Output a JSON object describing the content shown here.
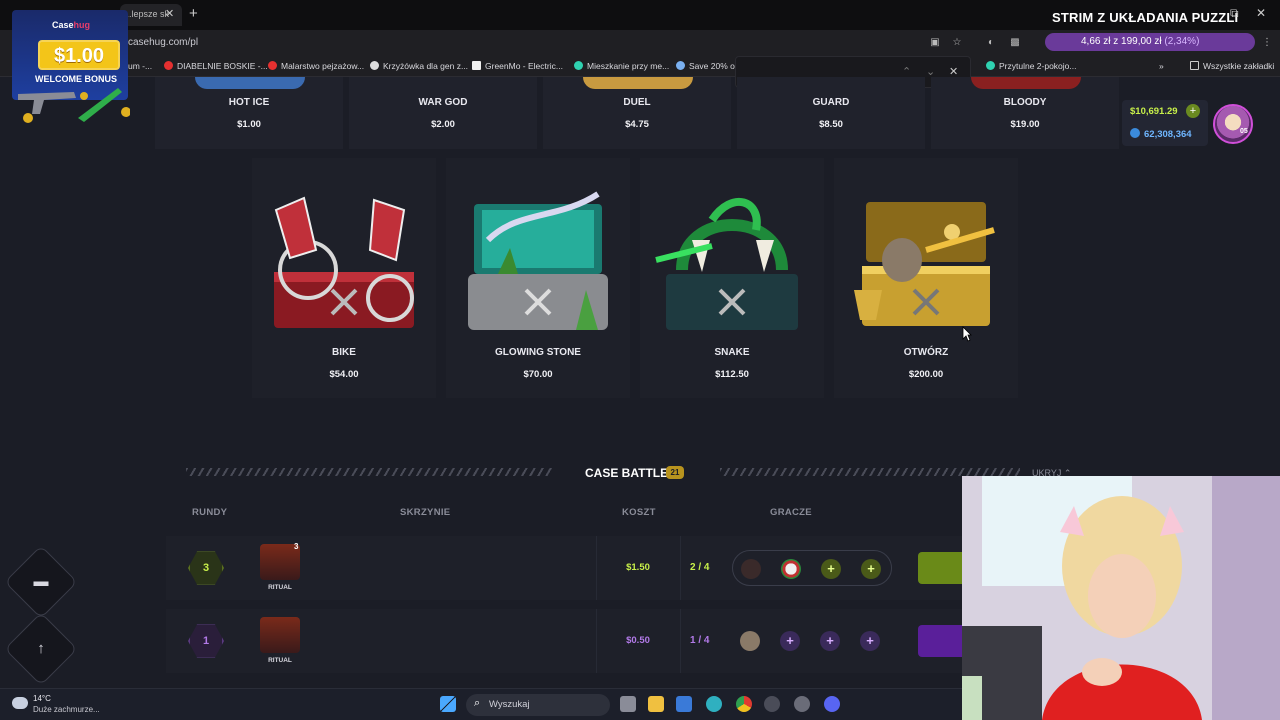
{
  "browser": {
    "tab_title": "...lepsze sk",
    "url": "casehug.com/pl",
    "bookmarks": [
      "um -...",
      "DIABELNIE BOSKIE -...",
      "Malarstwo pejzażow...",
      "Krzyżówka dla gen z...",
      "GreenMo - Electric...",
      "Mieszkanie przy me...",
      "Save 20% on",
      "Przytulne 2-pokojo...",
      "Wszystkie zakładki"
    ],
    "ticker": {
      "text": "4,66 zł z 199,00 zł",
      "pct": "(2,34%)"
    }
  },
  "stream_title": "STRIM Z UKŁADANIA PUZZLI",
  "promo": {
    "brand_a": "Case",
    "brand_b": "hug",
    "amount": "$1.00",
    "text": "WELCOME BONUS"
  },
  "balance": {
    "cash": "$10,691.29",
    "coins": "62,308,364",
    "level": "05"
  },
  "top_cases": [
    {
      "name": "HOT ICE",
      "price": "$1.00"
    },
    {
      "name": "WAR GOD",
      "price": "$2.00"
    },
    {
      "name": "DUEL",
      "price": "$4.75"
    },
    {
      "name": "GUARD",
      "price": "$8.50"
    },
    {
      "name": "BLOODY",
      "price": "$19.00"
    }
  ],
  "featured_cases": [
    {
      "name": "BIKE",
      "price": "$54.00"
    },
    {
      "name": "GLOWING STONE",
      "price": "$70.00"
    },
    {
      "name": "SNAKE",
      "price": "$112.50"
    },
    {
      "name": "OTWÓRZ",
      "price": "$200.00"
    }
  ],
  "battles": {
    "title": "CASE BATTLES",
    "count": "21",
    "hide_label": "UKRYJ",
    "columns": {
      "rounds": "RUNDY",
      "cases": "SKRZYNIE",
      "cost": "KOSZT",
      "players": "GRACZE"
    },
    "rows": [
      {
        "rounds": "3",
        "case_name": "RITUAL",
        "case_count": "3",
        "cost": "$1.50",
        "players": "2 / 4"
      },
      {
        "rounds": "1",
        "case_name": "RITUAL",
        "case_count": "",
        "cost": "$0.50",
        "players": "1 / 4"
      }
    ]
  },
  "taskbar": {
    "temp": "14°C",
    "weather": "Duże zachmurze...",
    "search_placeholder": "Wyszukaj"
  },
  "colors": {
    "bg": "#1b1d26",
    "card": "#1e2029",
    "accent_green": "#c8f04a",
    "accent_purple": "#a55ae6",
    "gold": "#b8931e"
  }
}
